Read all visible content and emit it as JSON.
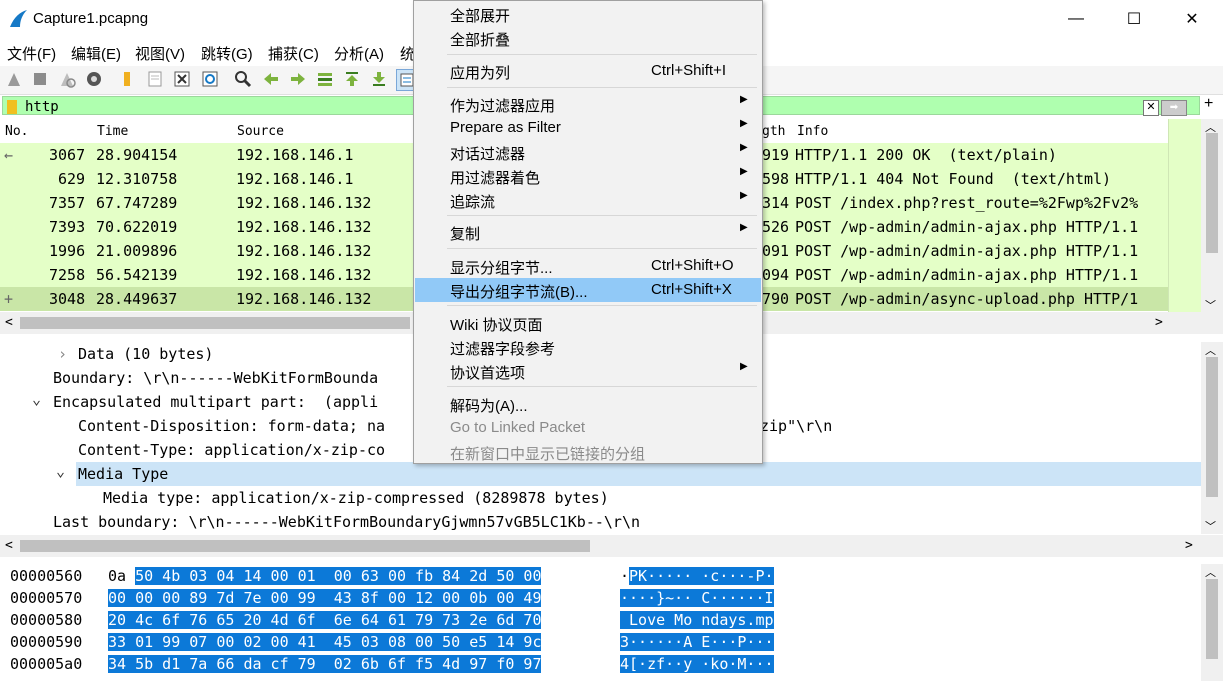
{
  "window": {
    "title": "Capture1.pcapng",
    "min_glyph": "—",
    "max_glyph": "☐",
    "close_glyph": "✕"
  },
  "menubar": {
    "items": [
      "文件(F)",
      "编辑(E)",
      "视图(V)",
      "跳转(G)",
      "捕获(C)",
      "分析(A)",
      "统"
    ]
  },
  "filter": {
    "value": "http",
    "clear_glyph": "✕",
    "apply_glyph": "➡",
    "add_glyph": "+"
  },
  "packet_list": {
    "columns": [
      "No.",
      "Time",
      "Source",
      "gth",
      "Info"
    ],
    "rows": [
      {
        "no": "3067",
        "time": "28.904154",
        "source": "192.168.146.1",
        "len": "919",
        "info": "HTTP/1.1 200 OK  (text/plain)"
      },
      {
        "no": "629",
        "time": "12.310758",
        "source": "192.168.146.1",
        "len": "598",
        "info": "HTTP/1.1 404 Not Found  (text/html)"
      },
      {
        "no": "7357",
        "time": "67.747289",
        "source": "192.168.146.132",
        "len": "314",
        "info": "POST /index.php?rest_route=%2Fwp%2Fv2%"
      },
      {
        "no": "7393",
        "time": "70.622019",
        "source": "192.168.146.132",
        "len": "526",
        "info": "POST /wp-admin/admin-ajax.php HTTP/1.1"
      },
      {
        "no": "1996",
        "time": "21.009896",
        "source": "192.168.146.132",
        "len": "091",
        "info": "POST /wp-admin/admin-ajax.php HTTP/1.1"
      },
      {
        "no": "7258",
        "time": "56.542139",
        "source": "192.168.146.132",
        "len": "094",
        "info": "POST /wp-admin/admin-ajax.php HTTP/1.1"
      },
      {
        "no": "3048",
        "time": "28.449637",
        "source": "192.168.146.132",
        "len": "790",
        "info": "POST /wp-admin/async-upload.php HTTP/1"
      }
    ]
  },
  "details": {
    "lines": [
      "Data (10 bytes)",
      "Boundary: \\r\\n------WebKitFormBounda",
      "Encapsulated multipart part:  (appli",
      "Content-Disposition: form-data; na",
      "Content-Type: application/x-zip-co",
      "Media Type",
      "Media type: application/x-zip-compressed (8289878 bytes)",
      "Last boundary: \\r\\n------WebKitFormBoundaryGjwmn57vGB5LC1Kb--\\r\\n"
    ],
    "tail_3": "zip\"\\r\\n"
  },
  "bytes": {
    "rows": [
      {
        "offset": "00000560",
        "hex_pre": "0a",
        "hex_sel": "50 4b 03 04 14 00 01  00 63 00 fb 84 2d 50 00",
        "ascii_pre": "·",
        "ascii_sel": "PK····· ·c···-P·"
      },
      {
        "offset": "00000570",
        "hex_pre": "",
        "hex_sel": "00 00 00 89 7d 7e 00 99  43 8f 00 12 00 0b 00 49",
        "ascii_pre": "",
        "ascii_sel": "····}~·· C······I"
      },
      {
        "offset": "00000580",
        "hex_pre": "",
        "hex_sel": "20 4c 6f 76 65 20 4d 6f  6e 64 61 79 73 2e 6d 70",
        "ascii_pre": "",
        "ascii_sel": " Love Mo ndays.mp"
      },
      {
        "offset": "00000590",
        "hex_pre": "",
        "hex_sel": "33 01 99 07 00 02 00 41  45 03 08 00 50 e5 14 9c",
        "ascii_pre": "",
        "ascii_sel": "3······A E···P···"
      },
      {
        "offset": "000005a0",
        "hex_pre": "",
        "hex_sel": "34 5b d1 7a 66 da cf 79  02 6b 6f f5 4d 97 f0 97",
        "ascii_pre": "",
        "ascii_sel": "4[·zf··y ·ko·M···"
      }
    ]
  },
  "context_menu": {
    "items": [
      {
        "label": "全部展开",
        "shortcut": "",
        "submenu": false,
        "disabled": false,
        "hover": false
      },
      {
        "label": "全部折叠",
        "shortcut": "",
        "submenu": false,
        "disabled": false,
        "hover": false
      },
      {
        "label": "应用为列",
        "shortcut": "Ctrl+Shift+I",
        "submenu": false,
        "disabled": false,
        "hover": false
      },
      {
        "label": "作为过滤器应用",
        "shortcut": "",
        "submenu": true,
        "disabled": false,
        "hover": false
      },
      {
        "label": "Prepare as Filter",
        "shortcut": "",
        "submenu": true,
        "disabled": false,
        "hover": false
      },
      {
        "label": "对话过滤器",
        "shortcut": "",
        "submenu": true,
        "disabled": false,
        "hover": false
      },
      {
        "label": "用过滤器着色",
        "shortcut": "",
        "submenu": true,
        "disabled": false,
        "hover": false
      },
      {
        "label": "追踪流",
        "shortcut": "",
        "submenu": true,
        "disabled": false,
        "hover": false
      },
      {
        "label": "复制",
        "shortcut": "",
        "submenu": true,
        "disabled": false,
        "hover": false
      },
      {
        "label": "显示分组字节...",
        "shortcut": "Ctrl+Shift+O",
        "submenu": false,
        "disabled": false,
        "hover": false
      },
      {
        "label": "导出分组字节流(B)...",
        "shortcut": "Ctrl+Shift+X",
        "submenu": false,
        "disabled": false,
        "hover": true
      },
      {
        "label": "Wiki 协议页面",
        "shortcut": "",
        "submenu": false,
        "disabled": false,
        "hover": false
      },
      {
        "label": "过滤器字段参考",
        "shortcut": "",
        "submenu": false,
        "disabled": false,
        "hover": false
      },
      {
        "label": "协议首选项",
        "shortcut": "",
        "submenu": true,
        "disabled": false,
        "hover": false
      },
      {
        "label": "解码为(A)...",
        "shortcut": "",
        "submenu": false,
        "disabled": false,
        "hover": false
      },
      {
        "label": "Go to Linked Packet",
        "shortcut": "",
        "submenu": false,
        "disabled": true,
        "hover": false
      },
      {
        "label": "在新窗口中显示已链接的分组",
        "shortcut": "",
        "submenu": false,
        "disabled": true,
        "hover": false
      }
    ],
    "arrow_glyph": "▶"
  },
  "icons": {
    "expand_glyph": "›",
    "collapse_glyph": "⌄",
    "scroll_up": "︿",
    "scroll_down": "﹀",
    "scroll_left": "<",
    "scroll_right": ">"
  }
}
